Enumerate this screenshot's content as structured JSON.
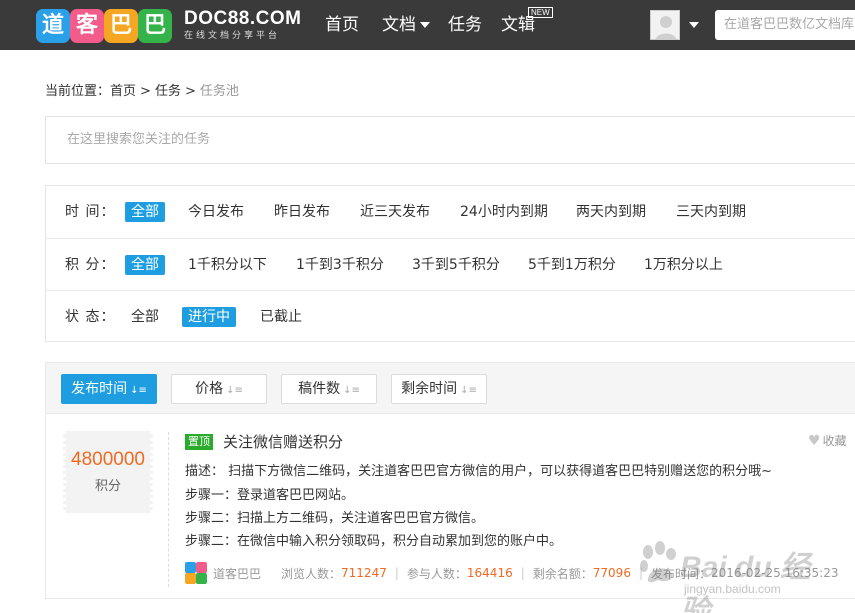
{
  "header": {
    "logo_chars": [
      "道",
      "客",
      "巴",
      "巴"
    ],
    "logo_colors": [
      "#2aa0e8",
      "#f35b8b",
      "#f5a623",
      "#34b34a"
    ],
    "brand_en": "DOC88.COM",
    "brand_cn": "在线文档分享平台",
    "nav": [
      {
        "label": "首页"
      },
      {
        "label": "文档",
        "has_dropdown": true
      },
      {
        "label": "任务"
      },
      {
        "label": "文辑",
        "badge": "NEW"
      }
    ],
    "search_placeholder": "在道客巴巴数亿文档库中"
  },
  "breadcrumb": {
    "prefix": "当前位置：",
    "items": [
      "首页",
      "任务"
    ],
    "current": "任务池",
    "separator": ">"
  },
  "task_search": {
    "placeholder": "在这里搜索您关注的任务"
  },
  "filters": [
    {
      "label": "时 间：",
      "options": [
        "全部",
        "今日发布",
        "昨日发布",
        "近三天发布",
        "24小时内到期",
        "两天内到期",
        "三天内到期"
      ],
      "selected": "全部"
    },
    {
      "label": "积 分：",
      "options": [
        "全部",
        "1千积分以下",
        "1千到3千积分",
        "3千到5千积分",
        "5千到1万积分",
        "1万积分以上"
      ],
      "selected": "全部"
    },
    {
      "label": "状 态：",
      "options": [
        "全部",
        "进行中",
        "已截止"
      ],
      "selected": "进行中"
    }
  ],
  "sort": {
    "buttons": [
      "发布时间",
      "价格",
      "稿件数",
      "剩余时间"
    ],
    "active": "发布时间"
  },
  "task": {
    "points": "4800000",
    "points_unit": "积分",
    "badge": "置顶",
    "title": "关注微信赠送积分",
    "fav_label": "收藏",
    "lines": [
      "描述： 扫描下方微信二维码，关注道客巴巴官方微信的用户，可以获得道客巴巴特别赠送您的积分哦~",
      "步骤一：登录道客巴巴网站。",
      "步骤二：扫描上方二维码，关注道客巴巴官方微信。",
      "步骤二：在微信中输入积分领取码，积分自动累加到您的账户中。"
    ],
    "publisher": "道客巴巴",
    "views_label": "浏览人数：",
    "views": "711247",
    "participants_label": "参与人数：",
    "participants": "164416",
    "remaining_label": "剩余名额：",
    "remaining": "77096",
    "published_label": "发布时间：",
    "published": "2016-02-25 16:35:23"
  },
  "watermark": {
    "text": "Bai du 经验",
    "sub": "jingyan.baidu.com"
  },
  "colors": {
    "accent": "#1e9ee0",
    "orange": "#f26a21",
    "green": "#2bab2b",
    "topbar": "#3a3a3a"
  }
}
